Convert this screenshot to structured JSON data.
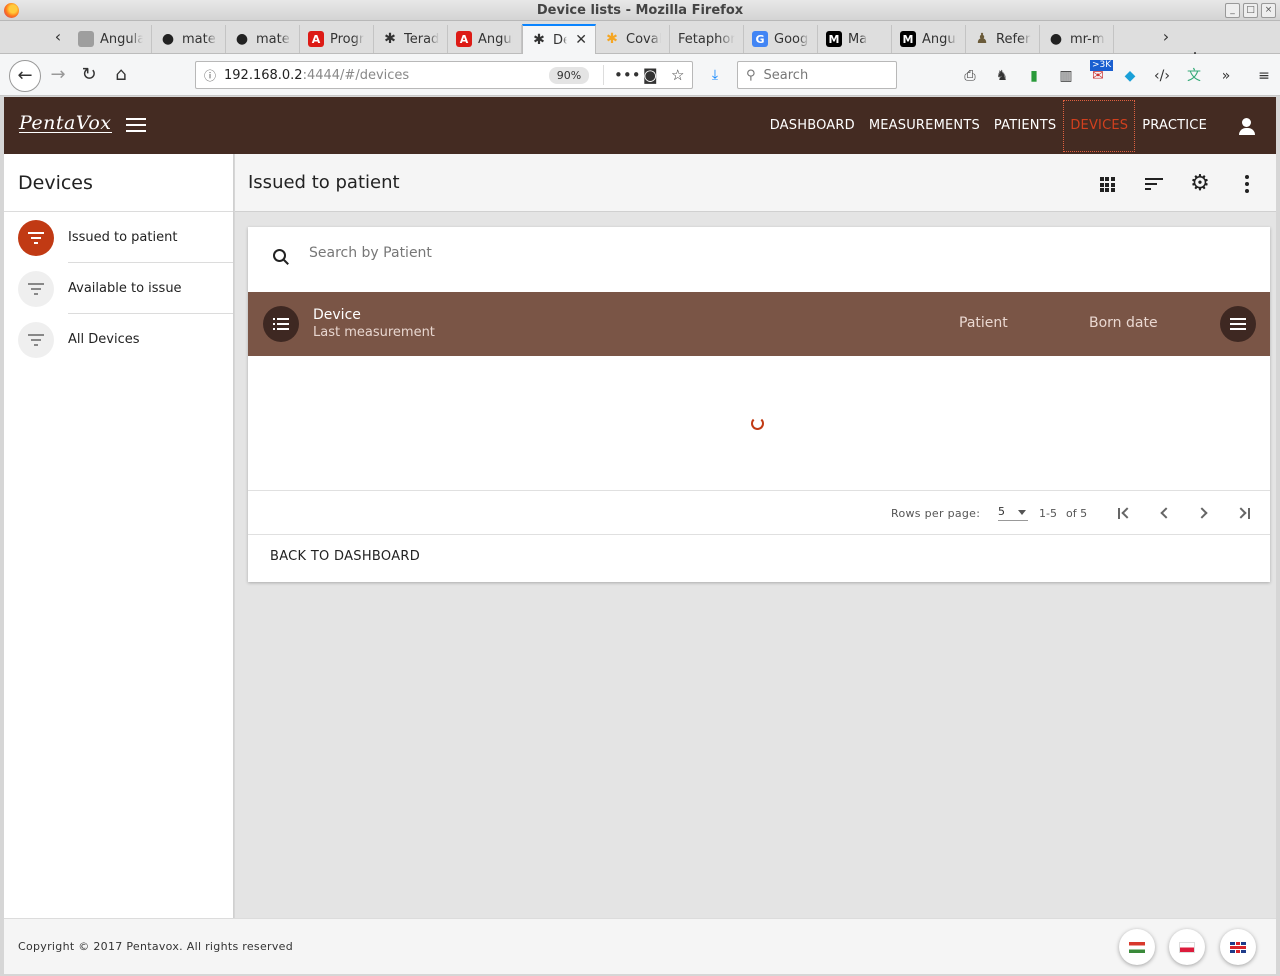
{
  "window": {
    "title": "Device lists - Mozilla Firefox"
  },
  "tabs": [
    {
      "label": "Angular M",
      "icon": "angular-material-icon",
      "color": "#9e9e9e"
    },
    {
      "label": "mater",
      "icon": "github-icon",
      "color": "#222222"
    },
    {
      "label": "mater",
      "icon": "github-icon",
      "color": "#222222"
    },
    {
      "label": "Progr",
      "icon": "angular-icon",
      "color": "#dd1b16"
    },
    {
      "label": "Terad",
      "icon": "covalent-icon",
      "color": "#333333"
    },
    {
      "label": "Angul",
      "icon": "angular-icon",
      "color": "#dd1b16"
    },
    {
      "label": "De",
      "icon": "covalent-icon",
      "color": "#333333",
      "active": true
    },
    {
      "label": "Coval",
      "icon": "covalent-icon",
      "color": "#f5a623"
    },
    {
      "label": "Fetaphon",
      "icon": "",
      "color": ""
    },
    {
      "label": "Googl",
      "icon": "google-translate-icon",
      "color": "#4285f4"
    },
    {
      "label": "Ma",
      "icon": "medium-icon",
      "color": "#000000"
    },
    {
      "label": "Angul",
      "icon": "medium-icon",
      "color": "#000000"
    },
    {
      "label": "Refere",
      "icon": "person-icon",
      "color": "#6b5b3a"
    },
    {
      "label": "mr-m",
      "icon": "github-icon",
      "color": "#222222"
    }
  ],
  "browser": {
    "url_host": "192.168.0.2",
    "url_path": ":4444/#/devices",
    "zoom": "90%",
    "search_placeholder": "Search",
    "badge": ">3K"
  },
  "app": {
    "logo": "PentaVox",
    "nav": [
      {
        "label": "DASHBOARD"
      },
      {
        "label": "MEASUREMENTS"
      },
      {
        "label": "PATIENTS"
      },
      {
        "label": "DEVICES",
        "active": true
      },
      {
        "label": "PRACTICE"
      }
    ],
    "accent": "#c13a14",
    "header_color": "#442b22"
  },
  "sidebar": {
    "title": "Devices",
    "items": [
      {
        "label": "Issued to patient",
        "active": true
      },
      {
        "label": "Available to issue"
      },
      {
        "label": "All Devices"
      }
    ]
  },
  "main": {
    "title": "Issued to patient",
    "search_placeholder": "Search by Patient",
    "table": {
      "col_device": "Device",
      "col_last_measurement": "Last measurement",
      "col_patient": "Patient",
      "col_born_date": "Born date",
      "header_color": "#7a5546"
    },
    "pager": {
      "rows_per_page_label": "Rows per page:",
      "rows_per_page": "5",
      "range": "1-5",
      "of_label": "of 5"
    },
    "back_label": "BACK TO DASHBOARD"
  },
  "footer": {
    "copyright": "Copyright © 2017 Pentavox. All rights reserved",
    "languages": [
      "hungarian-flag-icon",
      "polish-flag-icon",
      "english-flag-icon"
    ]
  }
}
